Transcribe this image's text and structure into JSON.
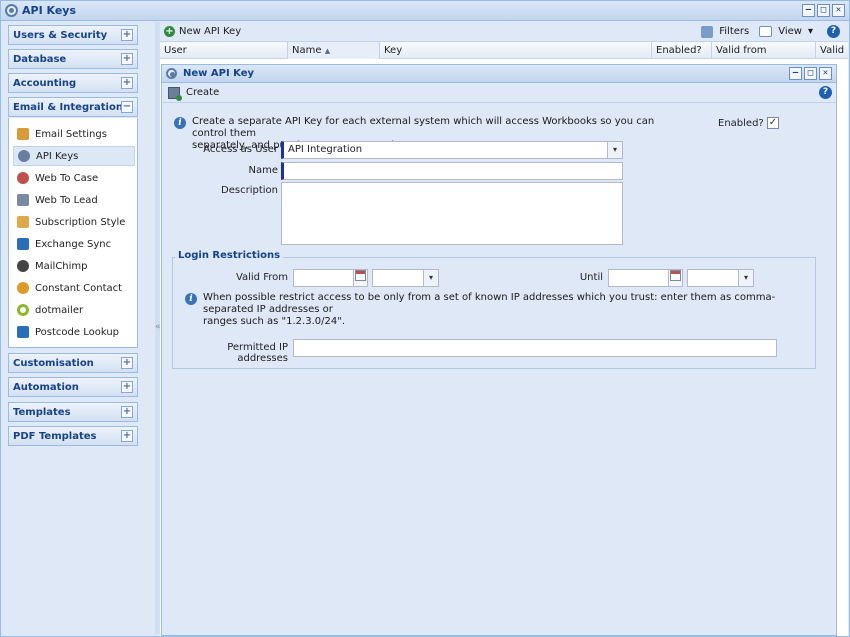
{
  "window": {
    "title": "API Keys"
  },
  "nav": {
    "sections_top": [
      {
        "label": "Users & Security",
        "toggle": "+"
      },
      {
        "label": "Database",
        "toggle": "+"
      },
      {
        "label": "Accounting",
        "toggle": "+"
      },
      {
        "label": "Email & Integration",
        "toggle": "−"
      }
    ],
    "items": [
      {
        "label": "Email Settings",
        "icon": "email-settings-icon",
        "color": "#d99a3a"
      },
      {
        "label": "API Keys",
        "icon": "gear-icon",
        "color": "#6a7fa0"
      },
      {
        "label": "Web To Case",
        "icon": "person-icon",
        "color": "#c0504d"
      },
      {
        "label": "Web To Lead",
        "icon": "web-lead-icon",
        "color": "#7a8aa0"
      },
      {
        "label": "Subscription Style",
        "icon": "subscription-icon",
        "color": "#e0a84a"
      },
      {
        "label": "Exchange Sync",
        "icon": "exchange-icon",
        "color": "#2a6ebb"
      },
      {
        "label": "MailChimp",
        "icon": "mailchimp-icon",
        "color": "#444444"
      },
      {
        "label": "Constant Contact",
        "icon": "constant-contact-icon",
        "color": "#e09a2a"
      },
      {
        "label": "dotmailer",
        "icon": "dotmailer-icon",
        "color": "#8bb82a"
      },
      {
        "label": "Postcode Lookup",
        "icon": "postcode-icon",
        "color": "#2a6ebb"
      }
    ],
    "sections_bottom": [
      {
        "label": "Customisation",
        "toggle": "+"
      },
      {
        "label": "Automation",
        "toggle": "+"
      },
      {
        "label": "Templates",
        "toggle": "+"
      },
      {
        "label": "PDF Templates",
        "toggle": "+"
      }
    ]
  },
  "main": {
    "new_button": "New API Key",
    "filters": "Filters",
    "view": "View",
    "view_arrow": "▾",
    "columns": [
      "User",
      "Name",
      "Key",
      "Enabled?",
      "Valid from",
      "Valid u"
    ],
    "sort_arrow": "▲"
  },
  "dialog": {
    "title": "New API Key",
    "create": "Create",
    "help": "?",
    "intro_line1": "Create a separate API Key for each external system which will access Workbooks so you can control them",
    "intro_line2": "separately, and put the system's name here.",
    "enabled_label": "Enabled?",
    "enabled_mark": "✓",
    "access_label": "Access as User",
    "access_value": "API Integration",
    "name_label": "Name",
    "name_value": "",
    "description_label": "Description",
    "description_value": "",
    "restrictions": {
      "legend": "Login Restrictions",
      "valid_from_label": "Valid From",
      "until_label": "Until",
      "info_line1": "When possible restrict access to be only from a set of known IP addresses which you trust: enter them as comma-separated IP addresses or",
      "info_line2": "ranges such as \"1.2.3.0/24\".",
      "ip_label": "Permitted IP addresses",
      "ip_value": ""
    }
  },
  "glyphs": {
    "plus": "+",
    "info": "i",
    "dropdown": "▾",
    "collapse": "«",
    "min": "–",
    "max": "□",
    "close": "✕"
  }
}
